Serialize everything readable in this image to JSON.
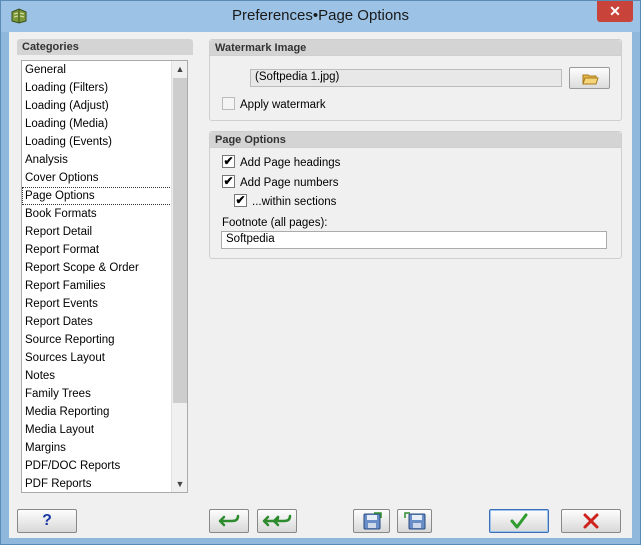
{
  "window": {
    "title": "Preferences•Page Options"
  },
  "categories": {
    "header": "Categories",
    "selected_index": 7,
    "items": [
      "General",
      "Loading (Filters)",
      "Loading (Adjust)",
      "Loading (Media)",
      "Loading (Events)",
      "Analysis",
      "Cover Options",
      "Page Options",
      "Book Formats",
      "Report Detail",
      "Report Format",
      "Report Scope & Order",
      "Report Families",
      "Report Events",
      "Report Dates",
      "Source Reporting",
      "Sources Layout",
      "Notes",
      "Family Trees",
      "Media Reporting",
      "Media Layout",
      "Margins",
      "PDF/DOC Reports",
      "PDF Reports"
    ]
  },
  "watermark": {
    "header": "Watermark Image",
    "file_value": "(Softpedia 1.jpg)",
    "apply_label": "Apply watermark",
    "apply_checked": false
  },
  "page_options": {
    "header": "Page Options",
    "add_headings_label": "Add Page headings",
    "add_headings_checked": true,
    "add_numbers_label": "Add Page numbers",
    "add_numbers_checked": true,
    "within_sections_label": "...within sections",
    "within_sections_checked": true,
    "footnote_label": "Footnote (all pages):",
    "footnote_value": "Softpedia"
  },
  "buttons": {
    "help_label": "?",
    "ok_icon": "checkmark-icon",
    "cancel_icon": "x-icon"
  },
  "colors": {
    "titlebar": "#9cc3e6",
    "close": "#c8433a",
    "ok_check": "#2e9c2e",
    "cancel_x": "#d0221c"
  }
}
